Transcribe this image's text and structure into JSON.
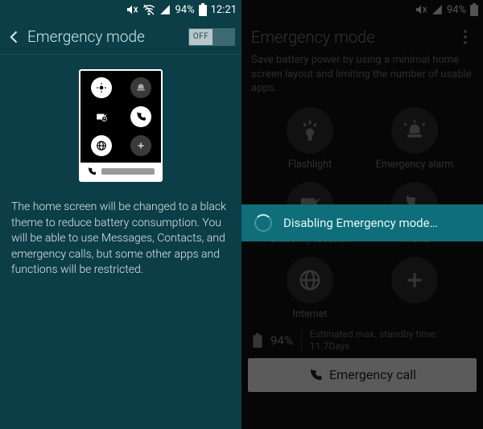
{
  "left": {
    "status": {
      "battery_pct": "94%",
      "time": "12:21"
    },
    "title": "Emergency mode",
    "toggle_label": "OFF",
    "description": "The home screen will be changed to a black theme to reduce battery consumption. You will be able to use Messages, Contacts, and emergency calls, but some other apps and functions will be restricted."
  },
  "right": {
    "status": {
      "battery_pct": "94%"
    },
    "title": "Emergency mode",
    "description": "Save battery power by using a minimal home screen layout and limiting the number of usable apps.",
    "apps": {
      "flashlight": "Flashlight",
      "alarm": "Emergency alarm",
      "share": "Share my location",
      "phone": "Phone",
      "internet": "Internet"
    },
    "battery": {
      "pct": "94%",
      "est_label": "Estimated max. standby time:",
      "est_value": "11.7Days"
    },
    "emergency_call": "Emergency call",
    "toast": "Disabling Emergency mode…"
  }
}
